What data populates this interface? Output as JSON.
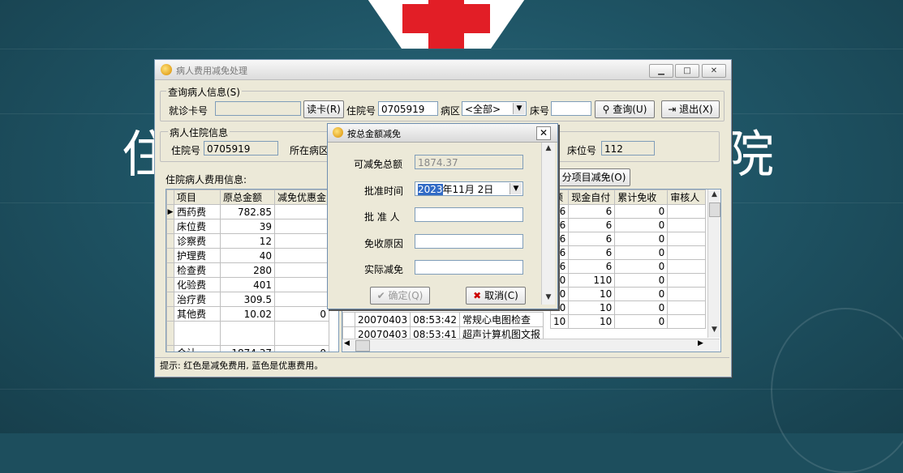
{
  "background": {
    "char_left": "住",
    "char_right": "院"
  },
  "window": {
    "title": "病人费用减免处理",
    "query_group": {
      "title": "查询病人信息(S)",
      "card_label": "就诊卡号",
      "card_value": "",
      "read_card_btn": "读卡(R)",
      "admission_label": "住院号",
      "admission_value": "0705919",
      "ward_label": "病区",
      "ward_value": "<全部>",
      "bed_label": "床号",
      "bed_value": "",
      "query_btn": "查询(U)",
      "exit_btn": "退出(X)"
    },
    "patient_group": {
      "title": "病人住院信息",
      "admission_label": "住院号",
      "admission_value": "0705919",
      "dept_label": "所在病区",
      "bed_label": "床位号",
      "bed_value": "112"
    },
    "fee_title": "住院病人费用信息:",
    "split_btn": "分项目减免(O)",
    "left_grid": {
      "headers": [
        "项目",
        "原总金额",
        "减免优惠金"
      ],
      "rows": [
        {
          "item": "西药费",
          "amount": "782.85",
          "discount": ""
        },
        {
          "item": "床位费",
          "amount": "39",
          "discount": ""
        },
        {
          "item": "诊察费",
          "amount": "12",
          "discount": ""
        },
        {
          "item": "护理费",
          "amount": "40",
          "discount": ""
        },
        {
          "item": "检查费",
          "amount": "280",
          "discount": ""
        },
        {
          "item": "化验费",
          "amount": "401",
          "discount": ""
        },
        {
          "item": "治疗费",
          "amount": "309.5",
          "discount": ""
        },
        {
          "item": "其他费",
          "amount": "10.02",
          "discount": "0"
        },
        {
          "item": "",
          "amount": "",
          "discount": ""
        }
      ],
      "total": {
        "item": "合计",
        "amount": "1874.37",
        "discount": "0"
      }
    },
    "right_grid": {
      "headers": [
        "额",
        "现金自付",
        "累计免收",
        "审核人"
      ],
      "rows": [
        {
          "a": "6",
          "b": "6",
          "c": "0"
        },
        {
          "a": "6",
          "b": "6",
          "c": "0"
        },
        {
          "a": "6",
          "b": "6",
          "c": "0"
        },
        {
          "a": "6",
          "b": "6",
          "c": "0"
        },
        {
          "a": "6",
          "b": "6",
          "c": "0"
        },
        {
          "a": "10",
          "b": "110",
          "c": "0"
        },
        {
          "a": "10",
          "b": "10",
          "c": "0"
        },
        {
          "a": "10",
          "b": "10",
          "c": "0"
        },
        {
          "a": "10",
          "b": "10",
          "c": "0"
        }
      ],
      "left_rows": [
        {
          "date": "20070403",
          "time": "08:53:42",
          "desc": "常规心电图检查"
        },
        {
          "date": "20070403",
          "time": "08:53:41",
          "desc": "超声计算机图文报"
        }
      ]
    },
    "status_text": "提示: 红色是减免费用, 蓝色是优惠费用。"
  },
  "dialog": {
    "title": "按总金额减免",
    "total_label": "可减免总额",
    "total_value": "1874.37",
    "date_label": "批准时间",
    "date_year": "2023",
    "date_rest": "年11月 2日",
    "approver_label": "批 准 人",
    "approver_value": "",
    "reason_label": "免收原因",
    "reason_value": "",
    "actual_label": "实际减免",
    "actual_value": "",
    "ok_btn": "确定(Q)",
    "cancel_btn": "取消(C)"
  }
}
